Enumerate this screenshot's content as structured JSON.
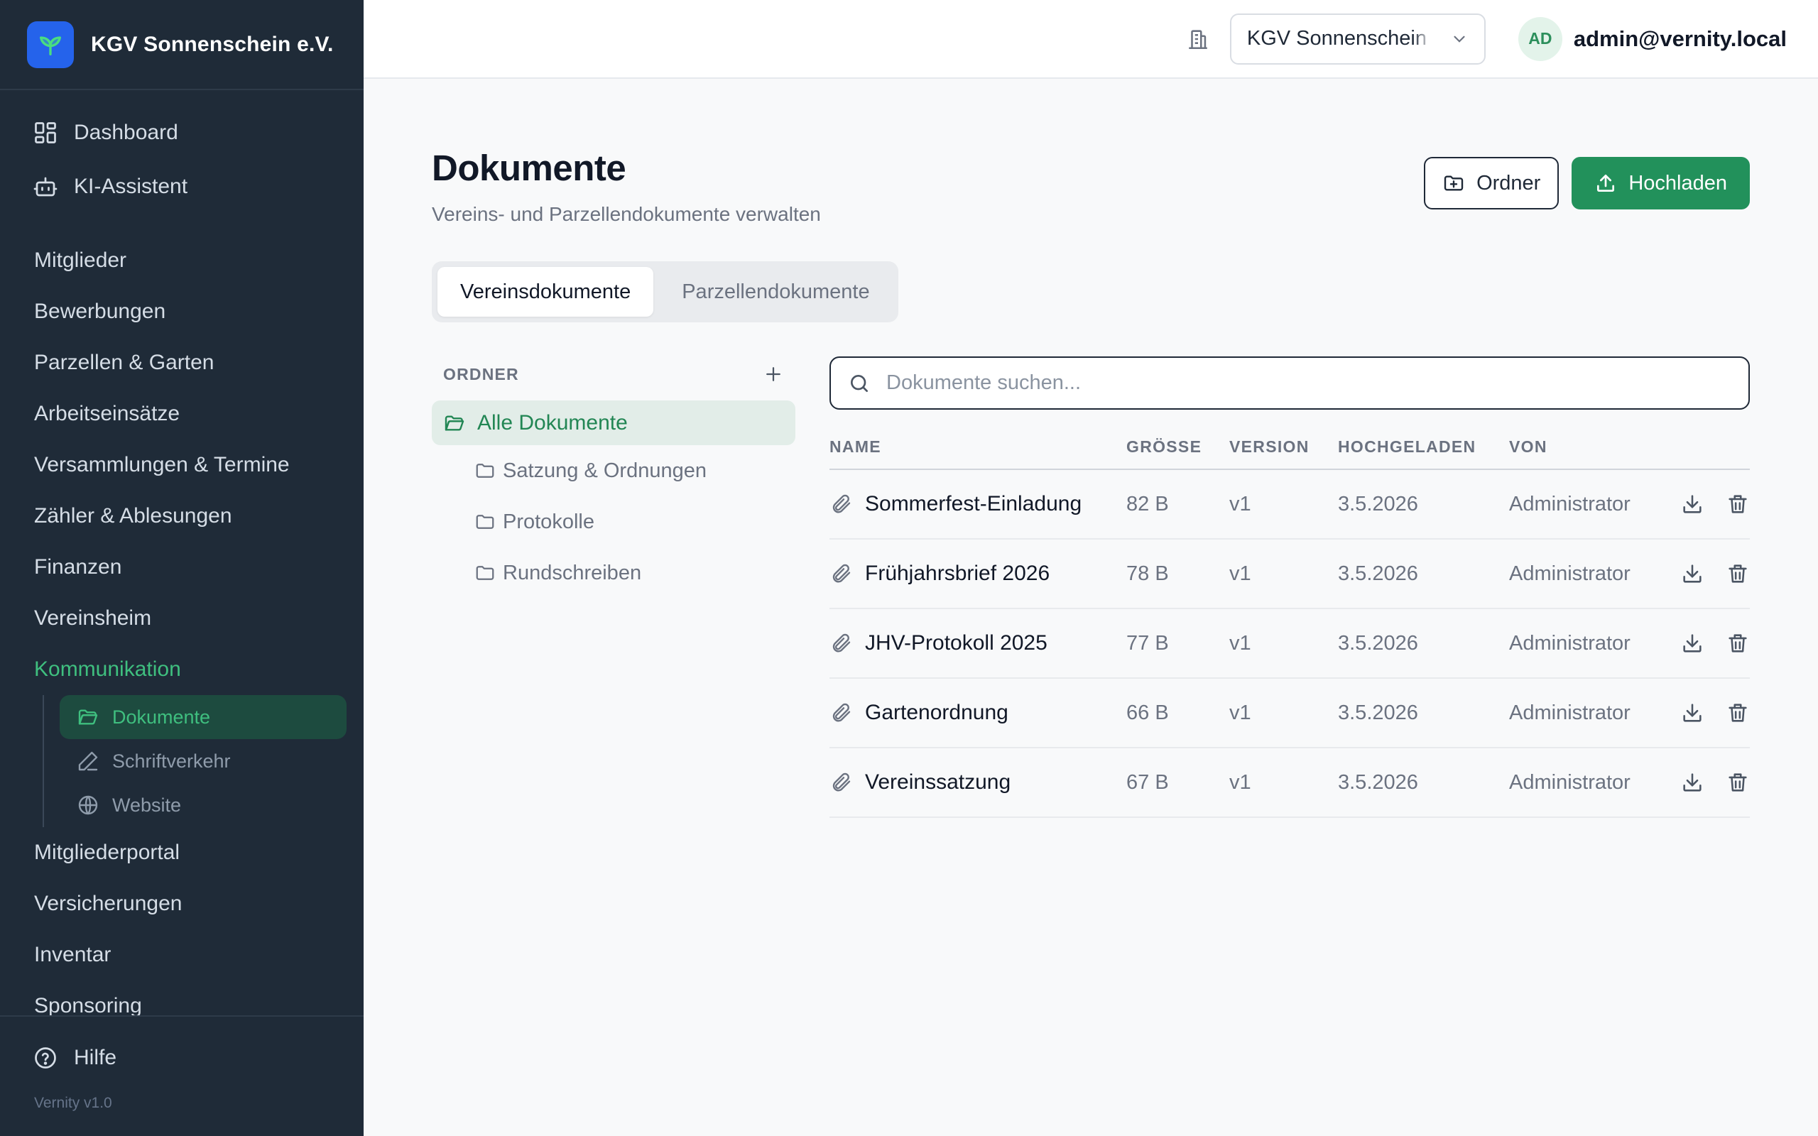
{
  "brand": {
    "name": "KGV Sonnenschein e.V."
  },
  "nav_top": [
    {
      "label": "Dashboard",
      "icon": "dashboard-icon"
    },
    {
      "label": "KI-Assistent",
      "icon": "bot-icon"
    }
  ],
  "nav": [
    {
      "label": "Mitglieder"
    },
    {
      "label": "Bewerbungen"
    },
    {
      "label": "Parzellen & Garten"
    },
    {
      "label": "Arbeitseinsätze"
    },
    {
      "label": "Versammlungen & Termine"
    },
    {
      "label": "Zähler & Ablesungen"
    },
    {
      "label": "Finanzen"
    },
    {
      "label": "Vereinsheim"
    },
    {
      "label": "Kommunikation"
    }
  ],
  "subnav": [
    {
      "label": "Dokumente",
      "icon": "folder-open-icon"
    },
    {
      "label": "Schriftverkehr",
      "icon": "pen-icon"
    },
    {
      "label": "Website",
      "icon": "globe-icon"
    }
  ],
  "nav_after": [
    {
      "label": "Mitgliederportal"
    },
    {
      "label": "Versicherungen"
    },
    {
      "label": "Inventar"
    },
    {
      "label": "Sponsoring"
    }
  ],
  "footer": {
    "help": "Hilfe",
    "version": "Vernity v1.0"
  },
  "topbar": {
    "org": "KGV Sonnenschein e.V.",
    "avatar": "AD",
    "email": "admin@vernity.local"
  },
  "page": {
    "title": "Dokumente",
    "subtitle": "Vereins- und Parzellendokumente verwalten",
    "btn_folder": "Ordner",
    "btn_upload": "Hochladen"
  },
  "tabs": [
    "Vereinsdokumente",
    "Parzellendokumente"
  ],
  "folders": {
    "label": "ORDNER",
    "all": "Alle Dokumente",
    "items": [
      "Satzung & Ordnungen",
      "Protokolle",
      "Rundschreiben"
    ]
  },
  "search": {
    "placeholder": "Dokumente suchen..."
  },
  "table": {
    "headers": [
      "NAME",
      "GRÖSSE",
      "VERSION",
      "HOCHGELADEN",
      "VON"
    ],
    "rows": [
      {
        "name": "Sommerfest-Einladung",
        "size": "82 B",
        "version": "v1",
        "date": "3.5.2026",
        "by": "Administrator"
      },
      {
        "name": "Frühjahrsbrief 2026",
        "size": "78 B",
        "version": "v1",
        "date": "3.5.2026",
        "by": "Administrator"
      },
      {
        "name": "JHV-Protokoll 2025",
        "size": "77 B",
        "version": "v1",
        "date": "3.5.2026",
        "by": "Administrator"
      },
      {
        "name": "Gartenordnung",
        "size": "66 B",
        "version": "v1",
        "date": "3.5.2026",
        "by": "Administrator"
      },
      {
        "name": "Vereinssatzung",
        "size": "67 B",
        "version": "v1",
        "date": "3.5.2026",
        "by": "Administrator"
      }
    ]
  },
  "colors": {
    "accent": "#22915b",
    "sidebar": "#1f2b38",
    "active": "#3fbf7f"
  }
}
